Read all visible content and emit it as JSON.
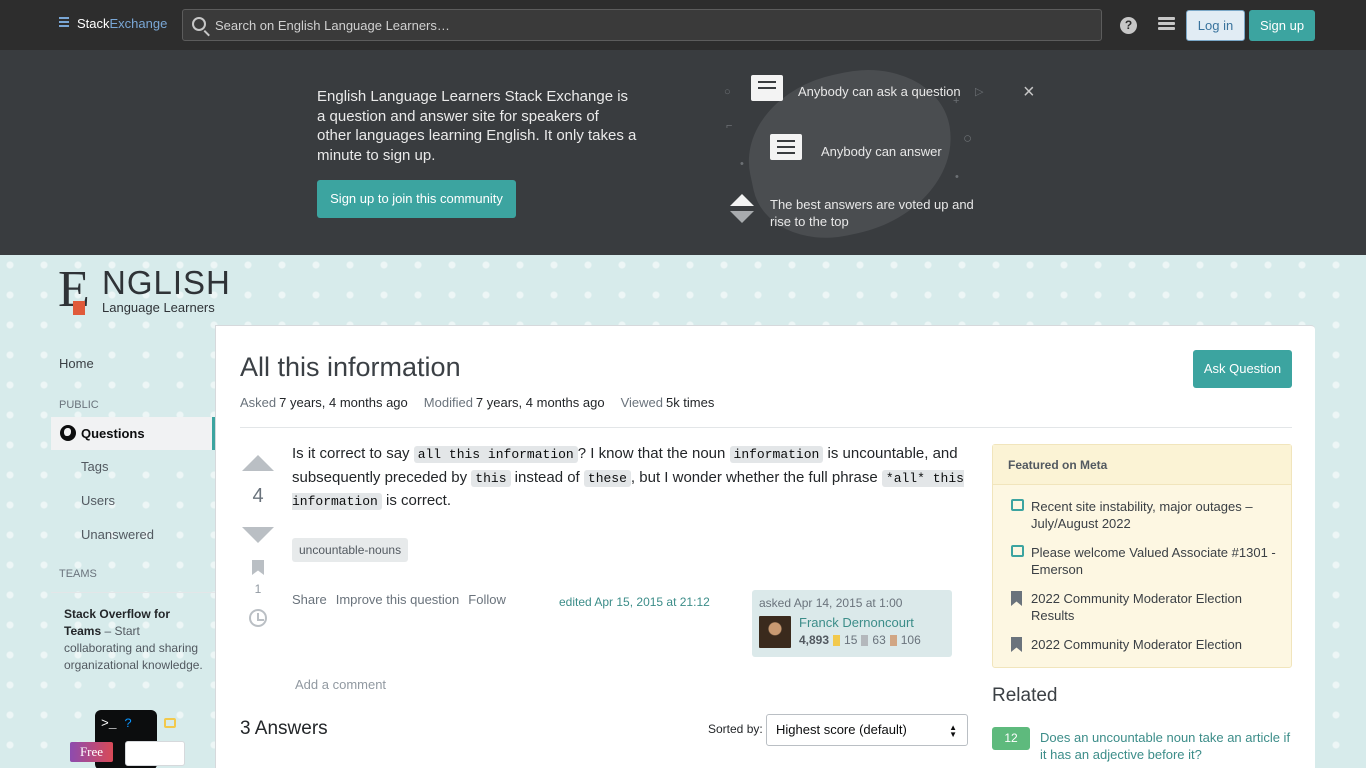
{
  "topbar": {
    "brand_a": "Stack",
    "brand_b": "Exchange",
    "search_placeholder": "Search on English Language Learners…",
    "help_glyph": "?",
    "login": "Log in",
    "signup": "Sign up"
  },
  "hero": {
    "text": "English Language Learners Stack Exchange is a question and answer site for speakers of other languages learning English. It only takes a minute to sign up.",
    "cta": "Sign up to join this community",
    "features": [
      "Anybody can ask a question",
      "Anybody can answer",
      "The best answers are voted up and rise to the top"
    ],
    "close_glyph": "×"
  },
  "site_logo": {
    "word": "NGLISH",
    "sub": "Language Learners"
  },
  "sidebar": {
    "home": "Home",
    "public": "PUBLIC",
    "questions": "Questions",
    "tags": "Tags",
    "users": "Users",
    "unanswered": "Unanswered",
    "teams": "TEAMS",
    "teams_title": "Stack Overflow for Teams",
    "teams_desc": " – Start collaborating and sharing organizational knowledge.",
    "teams_art_text": ">_",
    "teams_art_q": "?",
    "free": "Free"
  },
  "question": {
    "title": "All this information",
    "ask_button": "Ask Question",
    "asked_label": "Asked",
    "asked_value": "7 years, 4 months ago",
    "modified_label": "Modified",
    "modified_value": "7 years, 4 months ago",
    "viewed_label": "Viewed",
    "viewed_value": "5k times",
    "votes": "4",
    "bookmarks": "1",
    "body_parts": {
      "p1": "Is it correct to say ",
      "c1": "all this information",
      "p2": "? I know that the noun ",
      "c2": "information",
      "p3": " is uncountable, and subsequently preceded by ",
      "c3": "this",
      "p4": " instead of ",
      "c4": "these",
      "p5": ", but I wonder whether the full phrase ",
      "c5": "*all* this information",
      "p6": " is correct."
    },
    "tag": "uncountable-nouns",
    "menu": [
      "Share",
      "Improve this question",
      "Follow"
    ],
    "edited": "edited Apr 15, 2015 at 21:12",
    "asked_when": "asked Apr 14, 2015 at 1:00",
    "user": "Franck Dernoncourt",
    "rep": "4,893",
    "gold": "15",
    "silver": "63",
    "bronze": "106",
    "add_comment": "Add a comment"
  },
  "answers": {
    "count": "3 Answers",
    "sorted_by": "Sorted by:",
    "sort_value": "Highest score (default)"
  },
  "featured": {
    "header": "Featured on Meta",
    "items": [
      {
        "icon": "chat-icon",
        "text": "Recent site instability, major outages – July/August 2022"
      },
      {
        "icon": "chat-icon",
        "text": "Please welcome Valued Associate #1301 - Emerson"
      },
      {
        "icon": "bookmark-icon",
        "text": "2022 Community Moderator Election Results"
      },
      {
        "icon": "bookmark-icon",
        "text": "2022 Community Moderator Election"
      }
    ]
  },
  "related": {
    "title": "Related",
    "items": [
      {
        "score": "12",
        "text": "Does an uncountable noun take an article if it has an adjective before it?"
      }
    ]
  },
  "colors": {
    "accent": "#3ca4a0",
    "topbar": "#2d2d2d",
    "hero": "#393c3f",
    "link": "#3c8d89"
  }
}
